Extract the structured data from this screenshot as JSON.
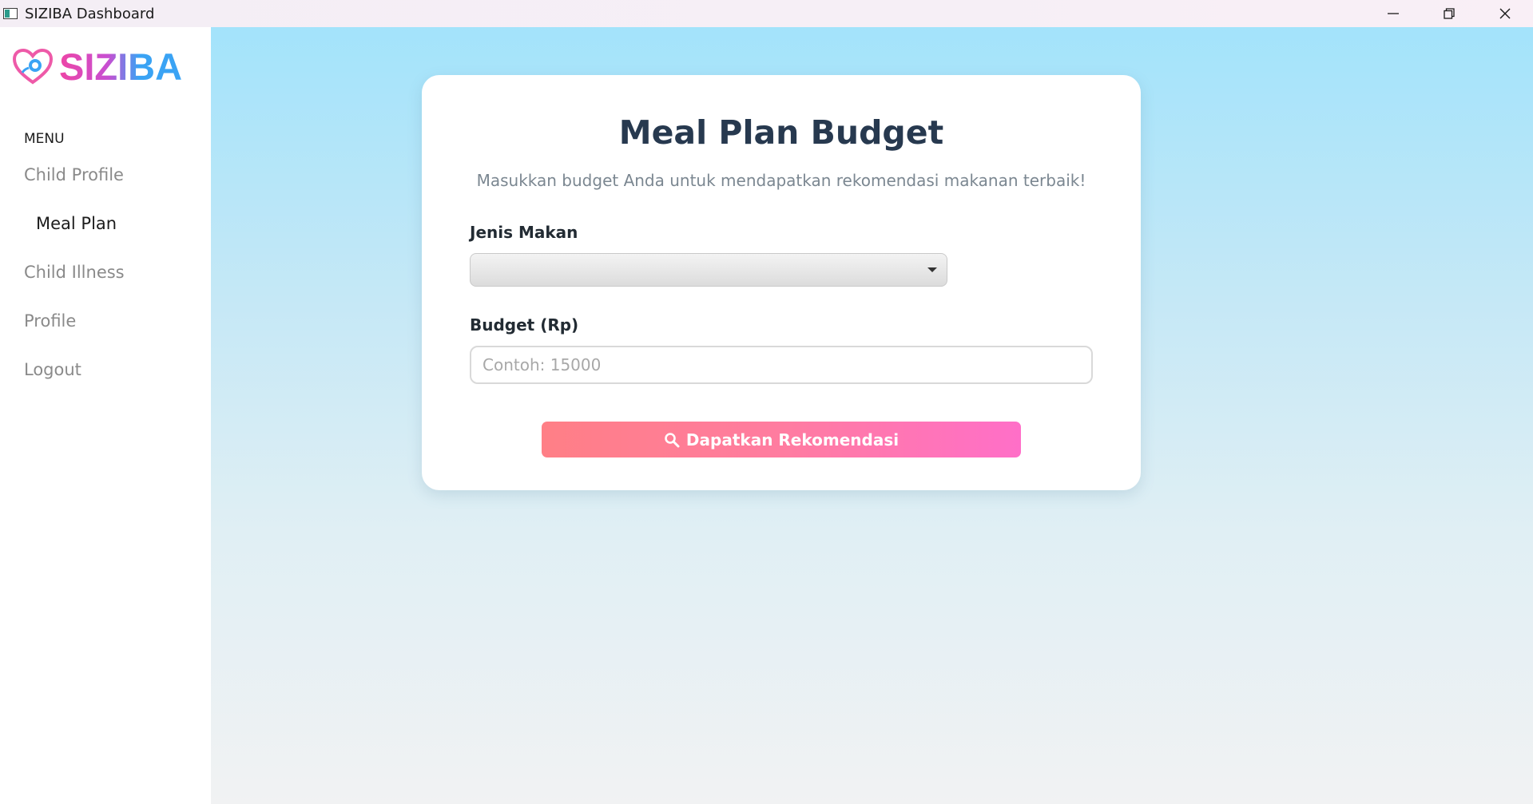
{
  "window": {
    "title": "SIZIBA Dashboard"
  },
  "sidebar": {
    "logo_text": "SIZIBA",
    "menu_label": "MENU",
    "items": [
      {
        "label": "Child Profile",
        "active": false
      },
      {
        "label": "Meal Plan",
        "active": true
      },
      {
        "label": "Child Illness",
        "active": false
      },
      {
        "label": "Profile",
        "active": false
      },
      {
        "label": "Logout",
        "active": false
      }
    ]
  },
  "main": {
    "title": "Meal Plan Budget",
    "subtitle": "Masukkan budget Anda untuk mendapatkan rekomendasi makanan terbaik!",
    "meal_type": {
      "label": "Jenis Makan",
      "value": ""
    },
    "budget": {
      "label": "Budget (Rp)",
      "value": "",
      "placeholder": "Contoh: 15000"
    },
    "submit_label": "Dapatkan Rekomendasi",
    "submit_icon": "search-icon"
  },
  "colors": {
    "title_text": "#27394f",
    "button_gradient_start": "#ff7f86",
    "button_gradient_end": "#ff6fc8",
    "logo_pink": "#ee45a6",
    "logo_blue": "#3aa3f4",
    "background_top": "#a3e3fb"
  }
}
